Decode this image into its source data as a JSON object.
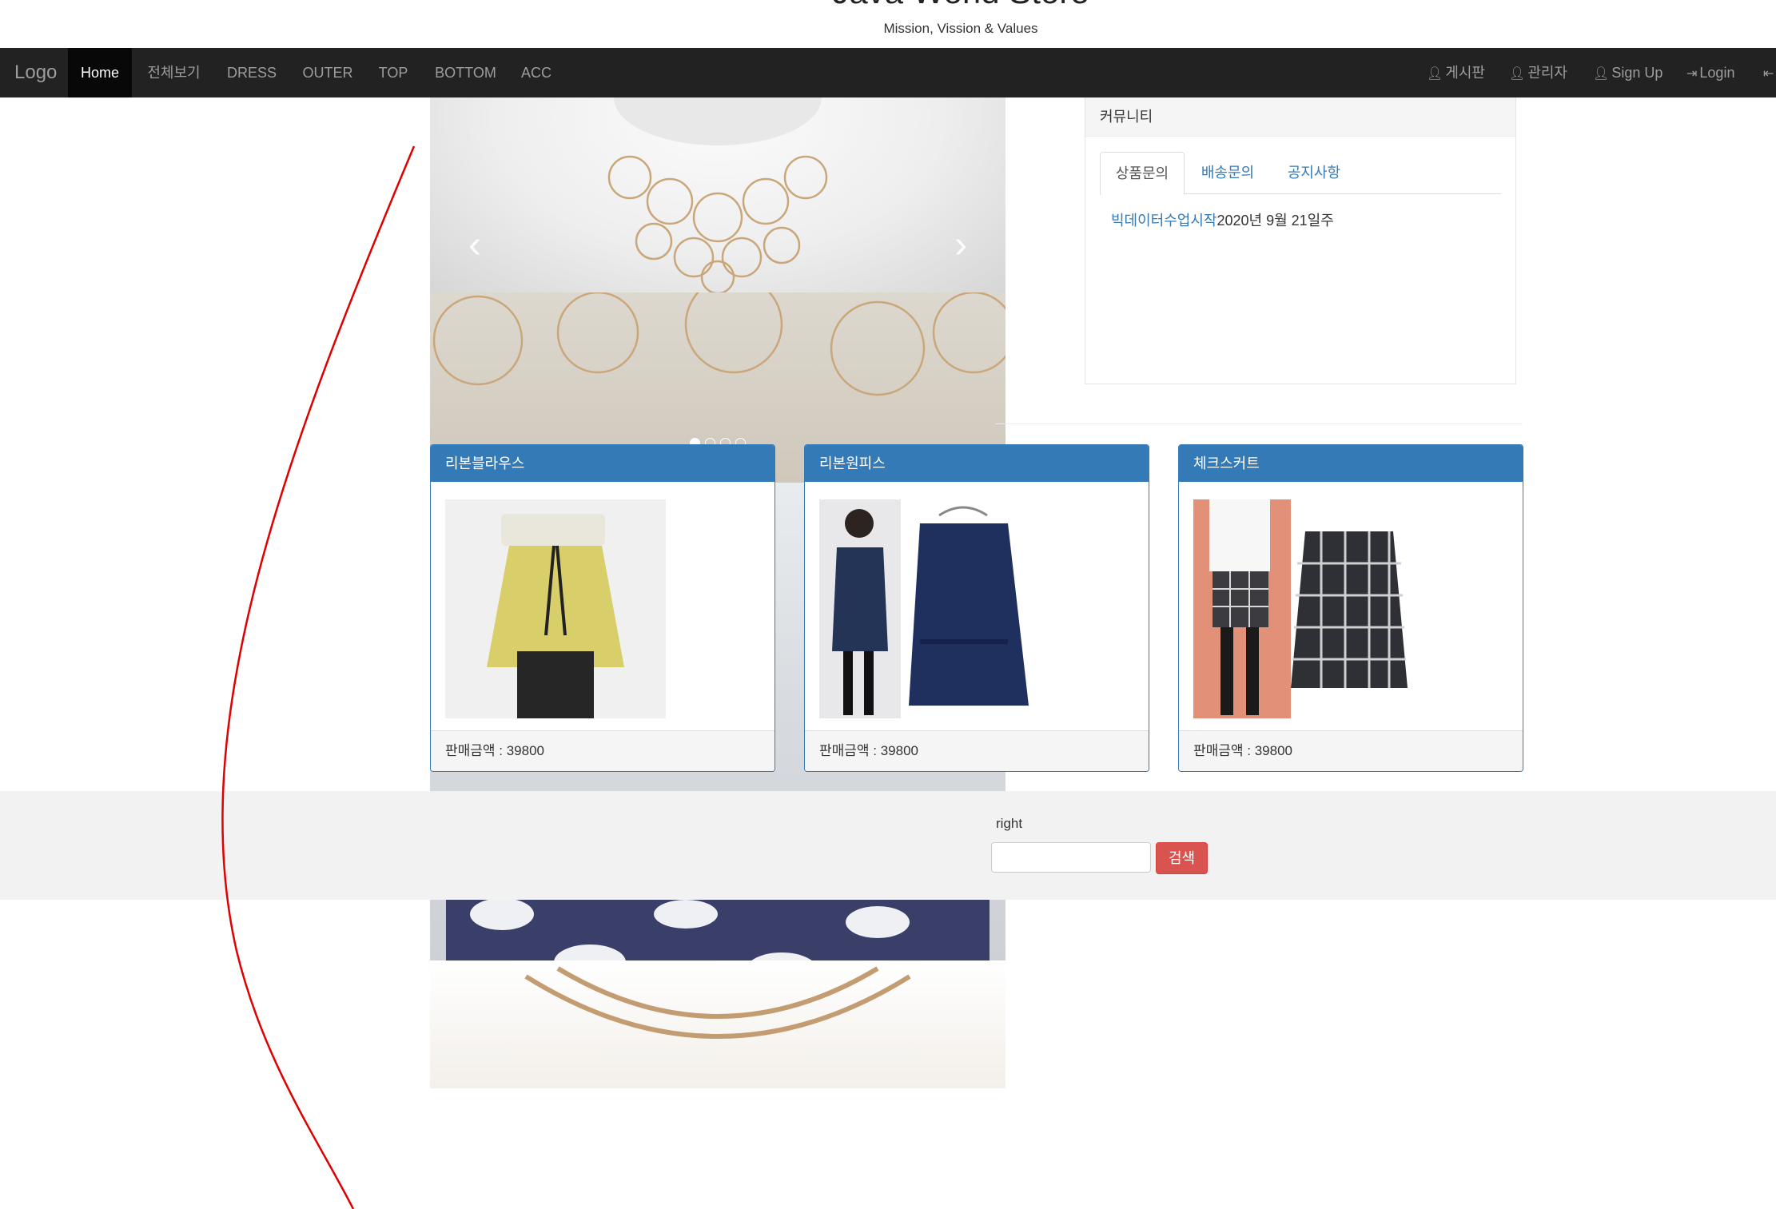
{
  "header": {
    "title": "Java World Store",
    "subtitle": "Mission, Vission & Values"
  },
  "nav": {
    "logo": "Logo",
    "items": [
      {
        "label": "Home",
        "active": true
      },
      {
        "label": "전체보기"
      },
      {
        "label": "DRESS"
      },
      {
        "label": "OUTER"
      },
      {
        "label": "TOP"
      },
      {
        "label": "BOTTOM"
      },
      {
        "label": "ACC"
      }
    ],
    "right": [
      {
        "label": "게시판",
        "icon": "user-icon"
      },
      {
        "label": "관리자",
        "icon": "user-icon"
      },
      {
        "label": "Sign Up",
        "icon": "user-icon"
      },
      {
        "label": "Login",
        "icon": "login-icon"
      }
    ]
  },
  "carousel": {
    "prev_glyph": "‹",
    "next_glyph": "›",
    "indicator_count": 4,
    "active_index": 0
  },
  "community": {
    "title": "커뮤니티",
    "tabs": [
      {
        "label": "상품문의",
        "active": true
      },
      {
        "label": "배송문의"
      },
      {
        "label": "공지사항"
      }
    ],
    "notice": {
      "link": "빅데이터수업시작",
      "date": "2020년 9월 21일주"
    }
  },
  "products": [
    {
      "name": "리본블라우스",
      "price_label": "판매금액 : 39800"
    },
    {
      "name": "리본원피스",
      "price_label": "판매금액 : 39800"
    },
    {
      "name": "체크스커트",
      "price_label": "판매금액 : 39800"
    }
  ],
  "footer": {
    "text": "right",
    "search_button": "검색"
  },
  "colors": {
    "navbar": "#222222",
    "primary": "#337ab7",
    "danger": "#d9534f",
    "annotation": "#e00000"
  }
}
